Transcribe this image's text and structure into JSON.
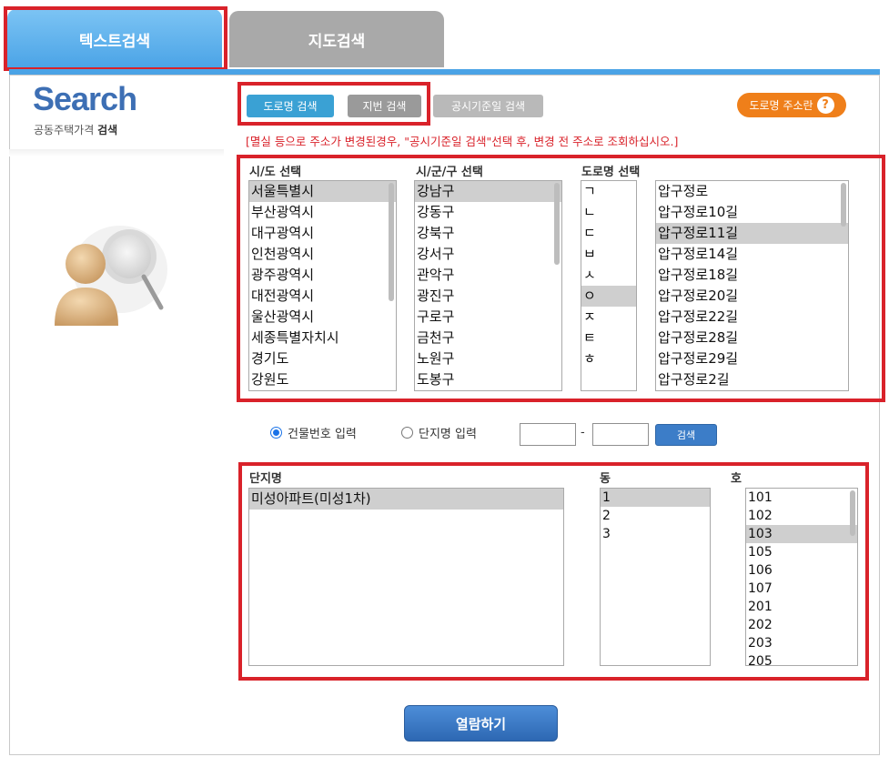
{
  "tabs": {
    "text_search": "텍스트검색",
    "map_search": "지도검색"
  },
  "logo": {
    "title": "Search",
    "subtitle_prefix": "공동주택가격",
    "subtitle_strong": "검색"
  },
  "modes": {
    "road": "도로명 검색",
    "lot": "지번 검색",
    "date": "공시기준일 검색",
    "road_help": "도로명 주소란",
    "help_icon": "?"
  },
  "notice": "[멸실 등으로 주소가 변경된경우, \"공시기준일 검색\"선택 후, 변경 전 주소로 조회하십시오.]",
  "address": {
    "sido": {
      "title": "시/도 선택",
      "selected_index": 0,
      "items": [
        "서울특별시",
        "부산광역시",
        "대구광역시",
        "인천광역시",
        "광주광역시",
        "대전광역시",
        "울산광역시",
        "세종특별자치시",
        "경기도",
        "강원도"
      ]
    },
    "sigungu": {
      "title": "시/군/구 선택",
      "selected_index": 0,
      "items": [
        "강남구",
        "강동구",
        "강북구",
        "강서구",
        "관악구",
        "광진구",
        "구로구",
        "금천구",
        "노원구",
        "도봉구"
      ]
    },
    "road": {
      "title": "도로명 선택",
      "consonants": [
        "ㄱ",
        "ㄴ",
        "ㄷ",
        "ㅂ",
        "ㅅ",
        "ㅇ",
        "ㅈ",
        "ㅌ",
        "ㅎ"
      ],
      "consonant_selected_index": 5,
      "selected_index": 2,
      "items": [
        "압구정로",
        "압구정로10길",
        "압구정로11길",
        "압구정로14길",
        "압구정로18길",
        "압구정로20길",
        "압구정로22길",
        "압구정로28길",
        "압구정로29길",
        "압구정로2길"
      ]
    }
  },
  "input_row": {
    "radio_building": "건물번호 입력",
    "radio_complex": "단지명 입력",
    "selected": "building",
    "first_value": "",
    "second_value": "",
    "dash": "-",
    "search_button": "검색"
  },
  "apartment": {
    "complex": {
      "title": "단지명",
      "selected_index": 0,
      "items": [
        "미성아파트(미성1차)"
      ]
    },
    "dong": {
      "title": "동",
      "selected_index": 0,
      "items": [
        "1",
        "2",
        "3"
      ]
    },
    "ho": {
      "title": "호",
      "selected_index": 2,
      "items": [
        "101",
        "102",
        "103",
        "105",
        "106",
        "107",
        "201",
        "202",
        "203",
        "205"
      ]
    }
  },
  "view_button": "열람하기",
  "colors": {
    "accent_red": "#d9222a",
    "tab_blue": "#4aa3e6",
    "road_blue": "#3aa1d4",
    "help_orange": "#ef7f1a"
  }
}
